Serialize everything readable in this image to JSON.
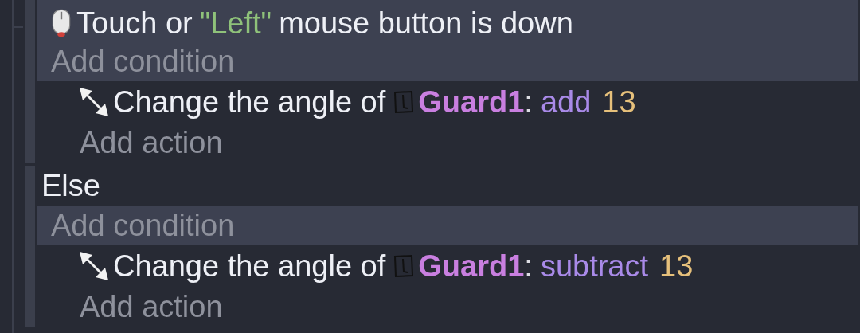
{
  "events": [
    {
      "kind": "standard",
      "conditions": [
        {
          "kind": "mouse",
          "parts": [
            {
              "kind": "plain",
              "text": "Touch or"
            },
            {
              "kind": "string",
              "text": "\"Left\""
            },
            {
              "kind": "plain",
              "text": "mouse button is down"
            }
          ]
        }
      ],
      "add_condition": "Add condition",
      "actions": [
        {
          "kind": "angle",
          "parts": [
            {
              "kind": "plain",
              "text": "Change the angle of"
            },
            {
              "kind": "object",
              "text": "Guard1"
            },
            {
              "kind": "colon",
              "text": ":"
            },
            {
              "kind": "operator",
              "text": "add"
            },
            {
              "kind": "number",
              "text": "13"
            }
          ]
        }
      ],
      "add_action": "Add action"
    },
    {
      "kind": "else",
      "label": "Else",
      "add_condition": "Add condition",
      "actions": [
        {
          "kind": "angle",
          "parts": [
            {
              "kind": "plain",
              "text": "Change the angle of"
            },
            {
              "kind": "object",
              "text": "Guard1"
            },
            {
              "kind": "colon",
              "text": ":"
            },
            {
              "kind": "operator",
              "text": "subtract"
            },
            {
              "kind": "number",
              "text": "13"
            }
          ]
        }
      ],
      "add_action": "Add action"
    }
  ]
}
